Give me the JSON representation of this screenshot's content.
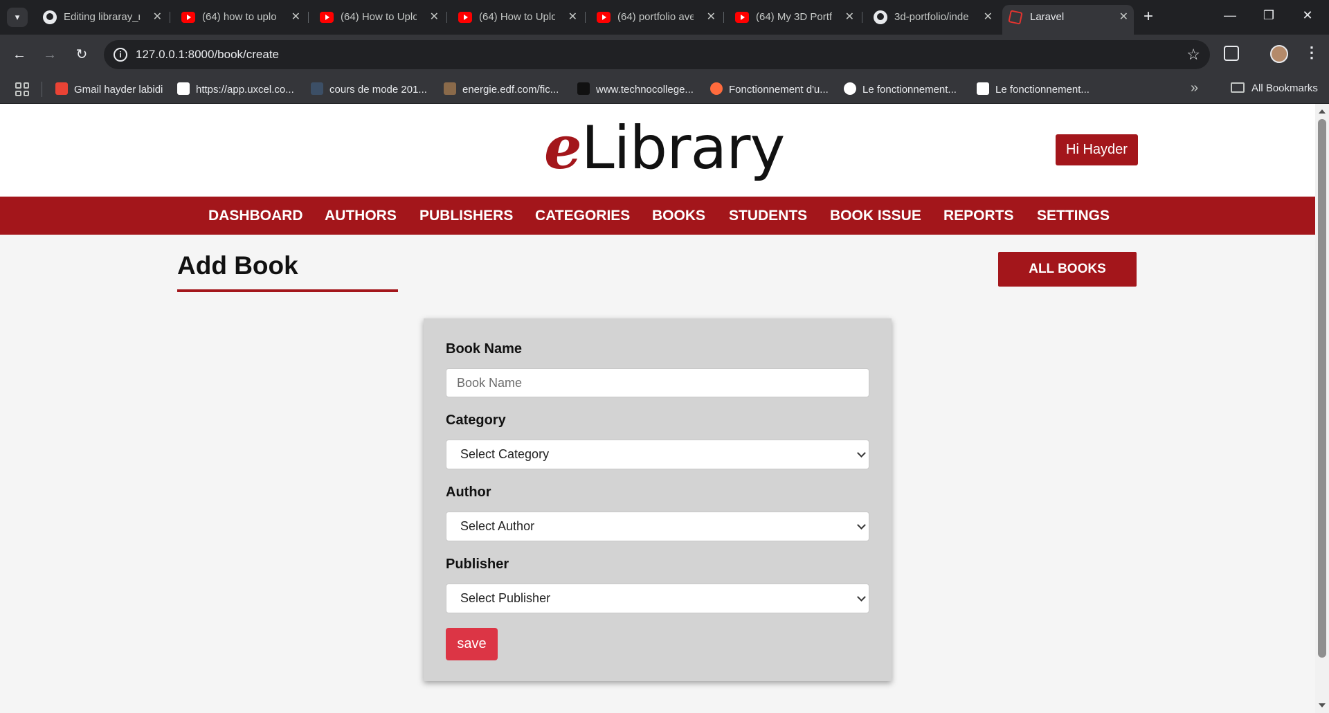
{
  "browser": {
    "tabs": [
      {
        "title": "Editing libraray_r",
        "favicon": "github-icon"
      },
      {
        "title": "(64) how to uplo",
        "favicon": "youtube-icon"
      },
      {
        "title": "(64) How to Uplo",
        "favicon": "youtube-icon"
      },
      {
        "title": "(64) How to Uplo",
        "favicon": "youtube-icon"
      },
      {
        "title": "(64) portfolio ave",
        "favicon": "youtube-icon"
      },
      {
        "title": "(64) My 3D Portf",
        "favicon": "youtube-icon"
      },
      {
        "title": "3d-portfolio/inde",
        "favicon": "github-icon"
      },
      {
        "title": "Laravel",
        "favicon": "laravel-icon",
        "active": true
      }
    ],
    "url": "127.0.0.1:8000/book/create",
    "bookmarks": [
      {
        "label": "Gmail hayder labidi",
        "color": "#ea4335"
      },
      {
        "label": "https://app.uxcel.co...",
        "color": "#ffffff"
      },
      {
        "label": "cours de mode 201...",
        "color": "#3c4f66"
      },
      {
        "label": "energie.edf.com/fic...",
        "color": "#8a6a4a"
      },
      {
        "label": "www.technocollege...",
        "color": "#111111"
      },
      {
        "label": "Fonctionnement d'u...",
        "color": "#ff6b3d"
      },
      {
        "label": "Le fonctionnement...",
        "color": "#ffffff"
      },
      {
        "label": "Le fonctionnement...",
        "color": "#ffffff"
      }
    ],
    "all_bookmarks": "All Bookmarks"
  },
  "header": {
    "logo_e": "e",
    "logo_rest": "Library",
    "user_greeting": "Hi Hayder"
  },
  "nav": {
    "items": [
      "DASHBOARD",
      "AUTHORS",
      "PUBLISHERS",
      "CATEGORIES",
      "BOOKS",
      "STUDENTS",
      "BOOK ISSUE",
      "REPORTS",
      "SETTINGS"
    ]
  },
  "main": {
    "title": "Add Book",
    "all_books_label": "ALL BOOKS",
    "form": {
      "book_name_label": "Book Name",
      "book_name_placeholder": "Book Name",
      "book_name_value": "",
      "category_label": "Category",
      "category_selected": "Select Category",
      "author_label": "Author",
      "author_selected": "Select Author",
      "publisher_label": "Publisher",
      "publisher_selected": "Select Publisher",
      "save_label": "save"
    }
  },
  "colors": {
    "brand": "#a3161b",
    "save": "#dc3545",
    "form_bg": "#d3d3d3",
    "page_bg": "#f5f5f5"
  }
}
